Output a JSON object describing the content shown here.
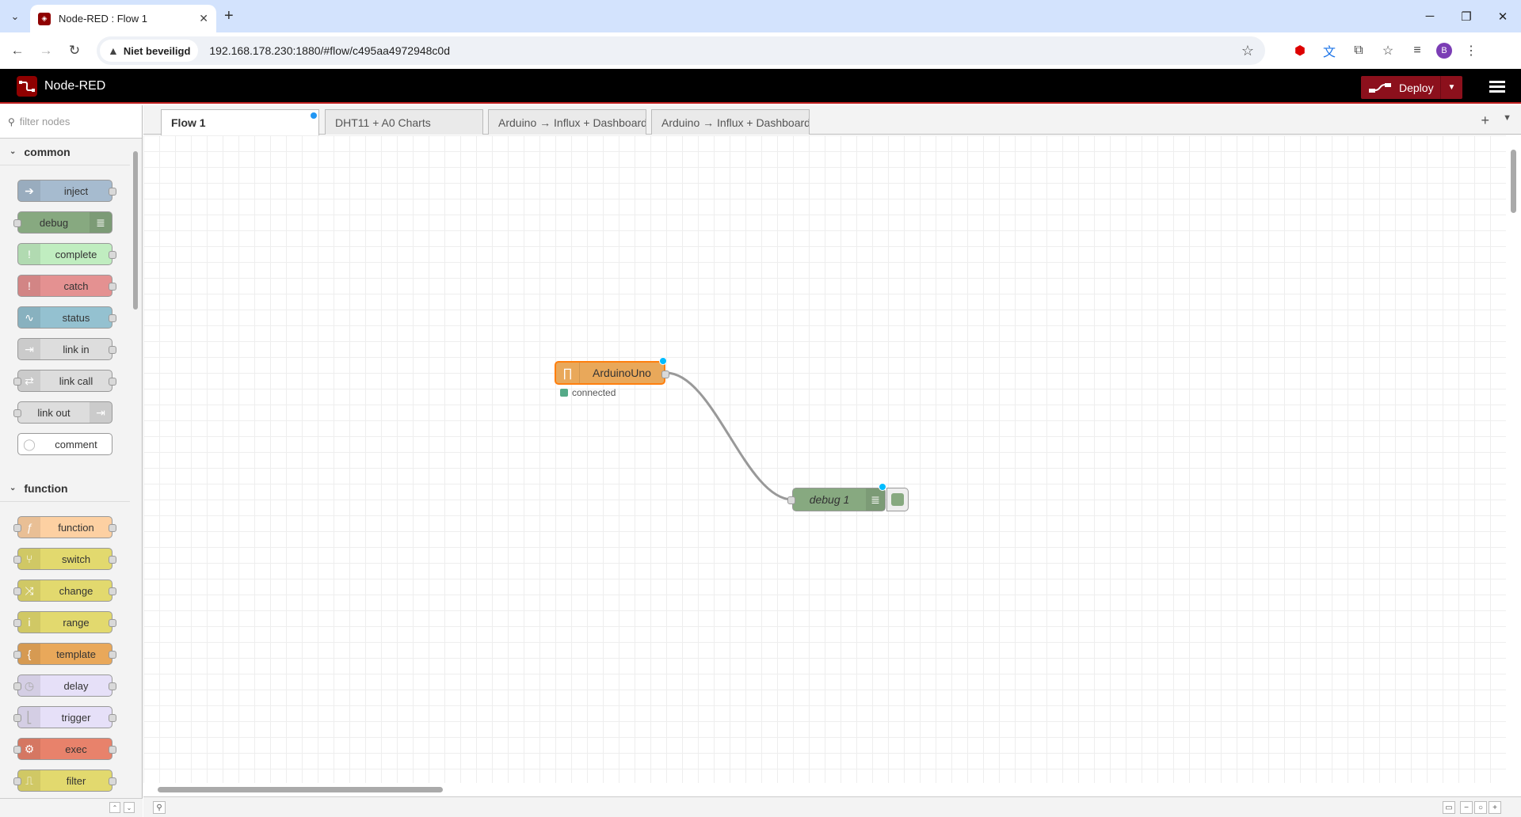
{
  "browser": {
    "tab_title": "Node-RED : Flow 1",
    "security_label": "Niet beveiligd",
    "url": "192.168.178.230:1880/#flow/c495aa4972948c0d",
    "avatar_letter": "B"
  },
  "header": {
    "title": "Node-RED",
    "deploy_label": "Deploy"
  },
  "palette": {
    "search_placeholder": "filter nodes",
    "categories": [
      {
        "label": "common",
        "nodes": [
          {
            "label": "inject",
            "color": "#a6bbcf"
          },
          {
            "label": "debug",
            "color": "#87a980"
          },
          {
            "label": "complete",
            "color": "#c0edc0"
          },
          {
            "label": "catch",
            "color": "#e49191"
          },
          {
            "label": "status",
            "color": "#94c1d0"
          },
          {
            "label": "link in",
            "color": "#dddddd"
          },
          {
            "label": "link call",
            "color": "#dddddd"
          },
          {
            "label": "link out",
            "color": "#dddddd"
          },
          {
            "label": "comment",
            "color": "#ffffff"
          }
        ]
      },
      {
        "label": "function",
        "nodes": [
          {
            "label": "function",
            "color": "#fdd0a2"
          },
          {
            "label": "switch",
            "color": "#e2d96e"
          },
          {
            "label": "change",
            "color": "#e2d96e"
          },
          {
            "label": "range",
            "color": "#e2d96e"
          },
          {
            "label": "template",
            "color": "#e9a85a"
          },
          {
            "label": "delay",
            "color": "#e6e0f8"
          },
          {
            "label": "trigger",
            "color": "#e6e0f8"
          },
          {
            "label": "exec",
            "color": "#e8826b"
          },
          {
            "label": "filter",
            "color": "#e2d96e"
          }
        ]
      }
    ]
  },
  "workspace": {
    "tabs": [
      {
        "label": "Flow 1",
        "active": true
      },
      {
        "label": "DHT11 + A0 Charts",
        "active": false
      },
      {
        "label": "Arduino → Influx + Dashboard",
        "active": false
      },
      {
        "label": "Arduino → Influx + Dashboard",
        "active": false
      }
    ],
    "nodes": {
      "arduino": {
        "label": "ArduinoUno",
        "status": "connected",
        "color": "#e9a85a"
      },
      "debug": {
        "label": "debug 1",
        "color": "#87a980"
      }
    }
  }
}
